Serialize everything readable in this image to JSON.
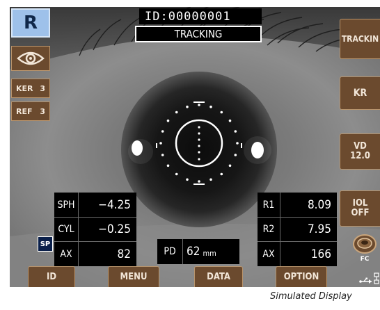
{
  "eye_side": "R",
  "header": {
    "id_text": "ID:00000001",
    "status": "TRACKING"
  },
  "left_panel": {
    "ker_label": "KER",
    "ker_value": "3",
    "ref_label": "REF",
    "ref_value": "3"
  },
  "right_buttons": {
    "tracking": "TRACKIN",
    "kr": "KR",
    "vd_line1": "VD",
    "vd_line2": "12.0",
    "iol_line1": "IOL",
    "iol_line2": "OFF",
    "fc": "FC"
  },
  "refraction": {
    "sph_label": "SPH",
    "sph_value": "−4.25",
    "cyl_label": "CYL",
    "cyl_value": "−0.25",
    "ax_label": "AX",
    "ax_value": "82"
  },
  "sp_badge": "SP",
  "pd": {
    "label": "PD",
    "value": "62",
    "unit": "mm"
  },
  "keratometry": {
    "r1_label": "R1",
    "r1_value": "8.09",
    "r2_label": "R2",
    "r2_value": "7.95",
    "ax_label": "AX",
    "ax_value": "166"
  },
  "bottom_buttons": {
    "id": "ID",
    "menu": "MENU",
    "data": "DATA",
    "option": "OPTION"
  },
  "caption": "Simulated Display"
}
